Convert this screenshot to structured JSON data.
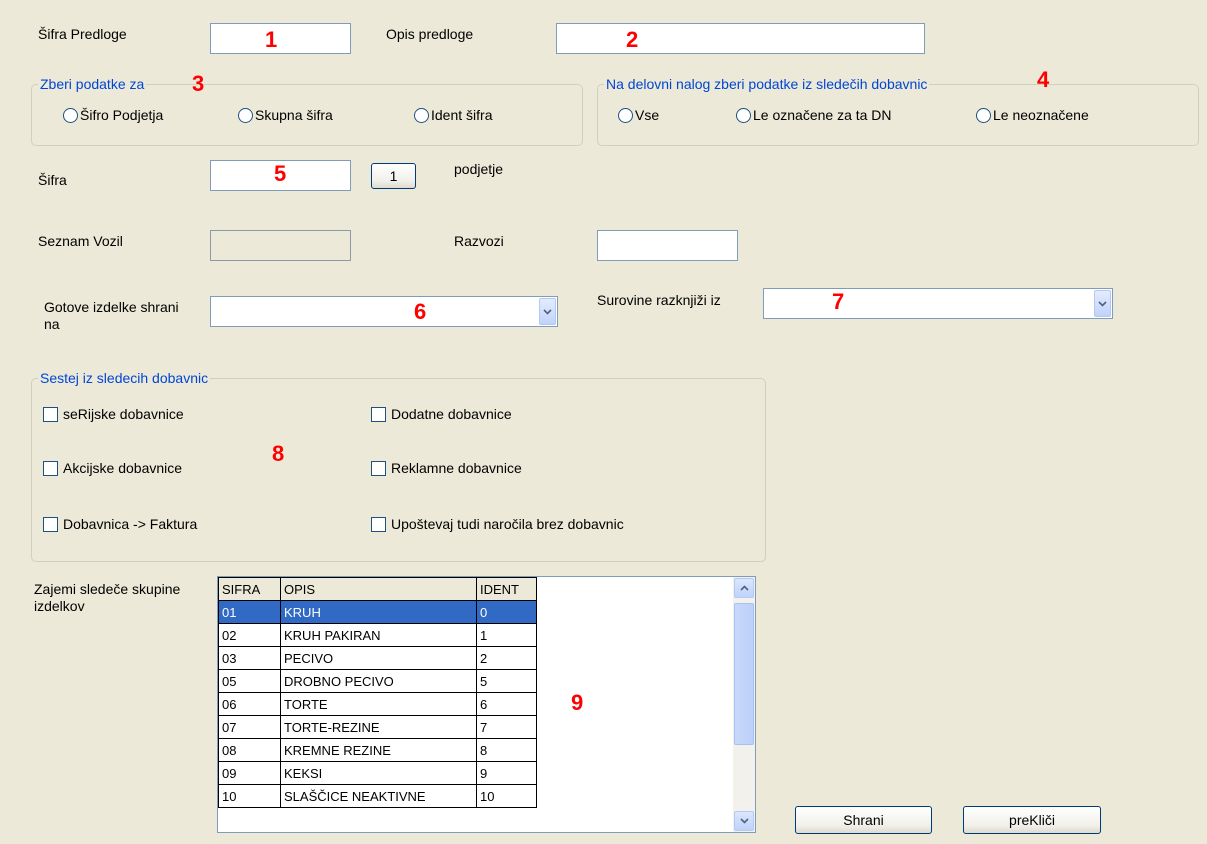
{
  "fields": {
    "sifra_predloge_label": "Šifra Predloge",
    "opis_predloge_label": "Opis predloge",
    "sifra_label": "Šifra",
    "sifra_button": "1",
    "podjetje_label": "podjetje",
    "seznam_vozil_label": "Seznam Vozil",
    "razvozi_label": "Razvozi",
    "gotove_label": "Gotove izdelke shrani na",
    "surovine_label": "Surovine razknjiži iz",
    "zajemi_label": "Zajemi sledeče skupine izdelkov"
  },
  "group_zberi": {
    "legend": "Zberi podatke za",
    "options": [
      "Šifro Podjetja",
      "Skupna šifra",
      "Ident šifra"
    ]
  },
  "group_delovni": {
    "legend": "Na delovni nalog zberi podatke iz sledečih dobavnic",
    "options": [
      "Vse",
      "Le označene za ta DN",
      "Le neoznačene"
    ]
  },
  "group_sestej": {
    "legend": "Sestej iz sledecih dobavnic",
    "checkboxes": [
      "seRijske dobavnice",
      "Dodatne dobavnice",
      "Akcijske dobavnice",
      "Reklamne dobavnice",
      "Dobavnica -> Faktura",
      "Upoštevaj tudi naročila brez dobavnic"
    ]
  },
  "markers": [
    "1",
    "2",
    "3",
    "4",
    "5",
    "6",
    "7",
    "8",
    "9"
  ],
  "grid": {
    "columns": [
      "SIFRA",
      "OPIS",
      "IDENT"
    ],
    "rows": [
      [
        "01",
        "KRUH",
        "0"
      ],
      [
        "02",
        "KRUH PAKIRAN",
        "1"
      ],
      [
        "03",
        "PECIVO",
        "2"
      ],
      [
        "05",
        "DROBNO PECIVO",
        "5"
      ],
      [
        "06",
        "TORTE",
        "6"
      ],
      [
        "07",
        "TORTE-REZINE",
        "7"
      ],
      [
        "08",
        "KREMNE REZINE",
        "8"
      ],
      [
        "09",
        "KEKSI",
        "9"
      ],
      [
        "10",
        "SLAŠČICE NEAKTIVNE",
        "10"
      ]
    ],
    "selected_row": 0
  },
  "buttons": {
    "save": "Shrani",
    "cancel": "preKliči"
  },
  "colors": {
    "background": "#ece9d8",
    "marker": "#ff0000",
    "legend": "#0046d5",
    "selection": "#316ac5"
  }
}
